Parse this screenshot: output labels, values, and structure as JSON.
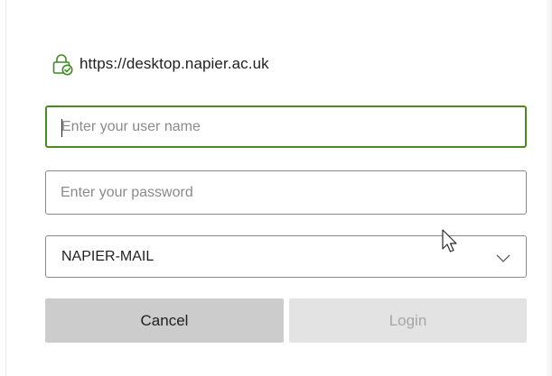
{
  "dialog": {
    "url": "https://desktop.napier.ac.uk",
    "username": {
      "value": "",
      "placeholder": "Enter your user name"
    },
    "password": {
      "value": "",
      "placeholder": "Enter your password"
    },
    "domain_select": {
      "selected": "NAPIER-MAIL"
    },
    "buttons": {
      "cancel_label": "Cancel",
      "login_label": "Login"
    }
  },
  "icons": {
    "lock": "secure-lock-icon",
    "chevron": "chevron-down-icon",
    "cursor": "mouse-pointer-icon"
  },
  "colors": {
    "focus_border": "#4b8a1f",
    "lock_green": "#3d8b1f",
    "cancel_bg": "#cccccc",
    "login_bg_disabled": "#e3e3e3",
    "login_text_disabled": "#a6a6a6"
  }
}
